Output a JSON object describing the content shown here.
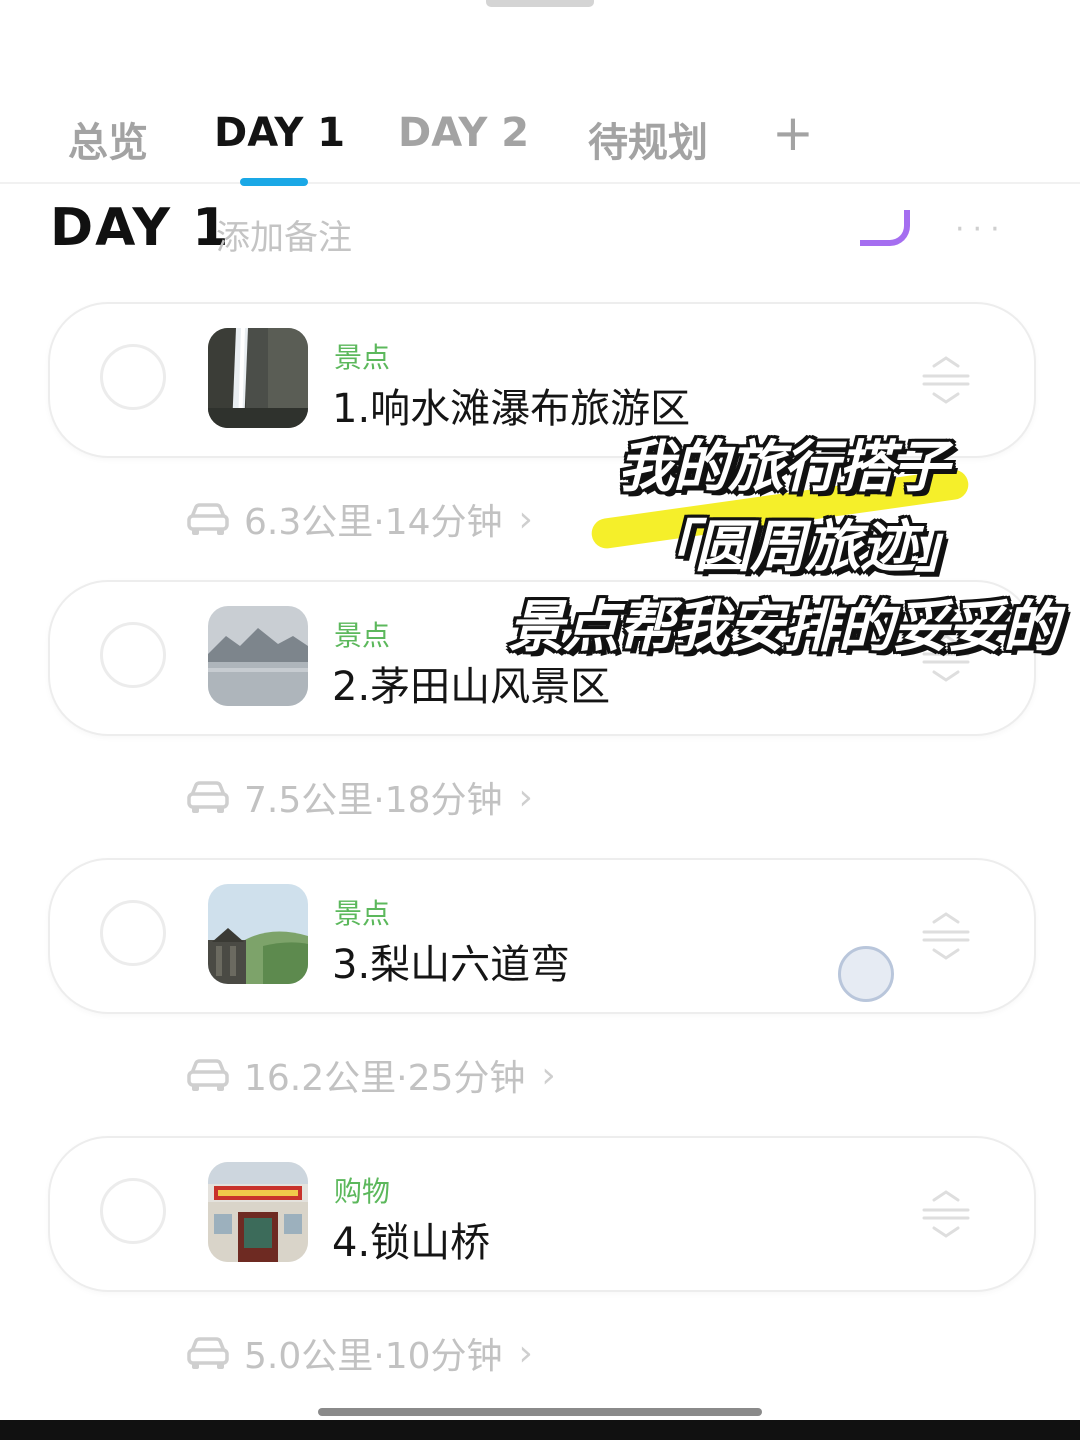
{
  "tabs": [
    {
      "label": "总览"
    },
    {
      "label": "DAY 1"
    },
    {
      "label": "DAY 2"
    },
    {
      "label": "待规划"
    }
  ],
  "tab_add_label": "+",
  "active_tab": "DAY 1",
  "colors": {
    "accent_tab_indicator": "#1aa8e6",
    "category_green": "#5cb85c",
    "highlight_yellow": "#f5ef2a"
  },
  "day_header": {
    "title": "DAY 1",
    "note_placeholder": "添加备注"
  },
  "stops": [
    {
      "category": "景点",
      "name": "1.响水滩瀑布旅游区",
      "thumb": "waterfall-photo"
    },
    {
      "category": "景点",
      "name": "2.茅田山风景区",
      "thumb": "lake-mountain-photo"
    },
    {
      "category": "景点",
      "name": "3.梨山六道弯",
      "thumb": "pavilion-hill-photo"
    },
    {
      "category": "购物",
      "name": "4.锁山桥",
      "thumb": "supermarket-storefront-photo"
    }
  ],
  "routes": [
    {
      "text": "6.3公里·14分钟"
    },
    {
      "text": "7.5公里·18分钟"
    },
    {
      "text": "16.2公里·25分钟"
    },
    {
      "text": "5.0公里·10分钟"
    }
  ],
  "overlay": {
    "line1": "我的旅行搭子",
    "line2": "「圆周旅迹」",
    "line3": "景点帮我安排的妥妥的"
  },
  "icons": {
    "route": "car-icon",
    "route_more": "chevron-right-icon",
    "reorder": "drag-handle-icon",
    "check": "circle-checkbox-icon"
  }
}
